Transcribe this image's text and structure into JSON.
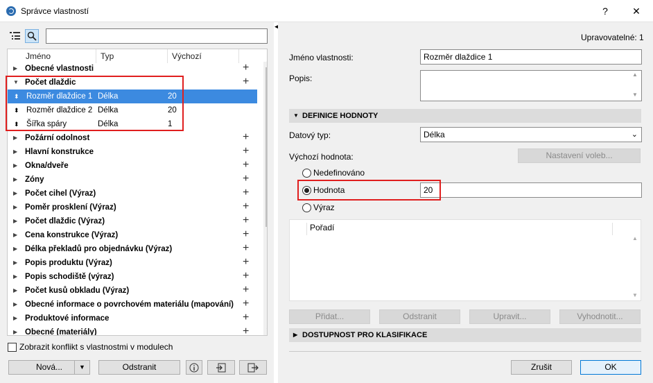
{
  "window": {
    "title": "Správce vlastností",
    "help_label": "?",
    "close_label": "✕"
  },
  "left": {
    "search_placeholder": "",
    "columns": [
      "Jméno",
      "Typ",
      "Výchozí"
    ],
    "groups": [
      {
        "label": "Obecné vlastnosti",
        "expanded": false
      },
      {
        "label": "Počet dlaždic",
        "expanded": true
      }
    ],
    "items": [
      {
        "name": "Rozměr dlaždice 1",
        "type": "Délka",
        "default": "20",
        "selected": true
      },
      {
        "name": "Rozměr dlaždice 2",
        "type": "Délka",
        "default": "20",
        "selected": false
      },
      {
        "name": "Šířka spáry",
        "type": "Délka",
        "default": "1",
        "selected": false
      }
    ],
    "more_groups": [
      "Požární odolnost",
      "Hlavní konstrukce",
      "Okna/dveře",
      "Zóny",
      "Počet cihel (Výraz)",
      "Poměr prosklení (Výraz)",
      "Počet dlaždic (Výraz)",
      "Cena konstrukce (Výraz)",
      "Délka překladů pro objednávku (Výraz)",
      "Popis produktu (Výraz)",
      "Popis schodiště (výraz)",
      "Počet kusů obkladu (Výraz)",
      "Obecné informace o povrchovém materiálu (mapování)",
      "Produktové informace",
      "Obecné (materiály)"
    ],
    "conflict_checkbox_label": "Zobrazit konflikt s vlastnostmi v modulech",
    "new_button": "Nová...",
    "delete_button": "Odstranit"
  },
  "right": {
    "editable_label": "Upravovatelné: 1",
    "name_label": "Jméno vlastnosti:",
    "name_value": "Rozměr dlaždice 1",
    "desc_label": "Popis:",
    "desc_value": "",
    "value_def_section": "DEFINICE HODNOTY",
    "datatype_label": "Datový typ:",
    "datatype_value": "Délka",
    "default_label": "Výchozí hodnota:",
    "options_button": "Nastavení voleb...",
    "radio_undefined": "Nedefinováno",
    "radio_value": "Hodnota",
    "radio_value_input": "20",
    "radio_expression": "Výraz",
    "order_header": "Pořadí",
    "add_button": "Přidat...",
    "remove_button": "Odstranit",
    "edit_button": "Upravit...",
    "evaluate_button": "Vyhodnotit...",
    "availability_section": "DOSTUPNOST PRO KLASIFIKACE",
    "cancel_button": "Zrušit",
    "ok_button": "OK"
  }
}
